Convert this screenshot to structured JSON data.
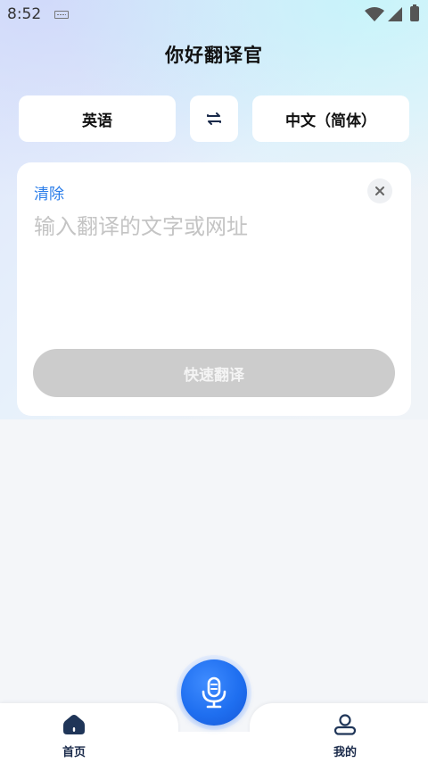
{
  "status_bar": {
    "time": "8:52"
  },
  "app": {
    "title": "你好翻译官"
  },
  "languages": {
    "source": "英语",
    "target": "中文（简体）"
  },
  "card": {
    "clear_label": "清除",
    "input_value": "",
    "input_placeholder": "输入翻译的文字或网址",
    "translate_label": "快速翻译"
  },
  "nav": {
    "home_label": "首页",
    "mine_label": "我的"
  },
  "colors": {
    "accent": "#2b7de9",
    "mic": "#1f6ff0",
    "disabled_button": "#cccccc",
    "nav_icon": "#1a2a4a"
  },
  "icons": {
    "swap": "swap-arrows-icon",
    "close": "close-icon",
    "mic": "microphone-icon",
    "home": "home-icon",
    "profile": "user-icon"
  }
}
